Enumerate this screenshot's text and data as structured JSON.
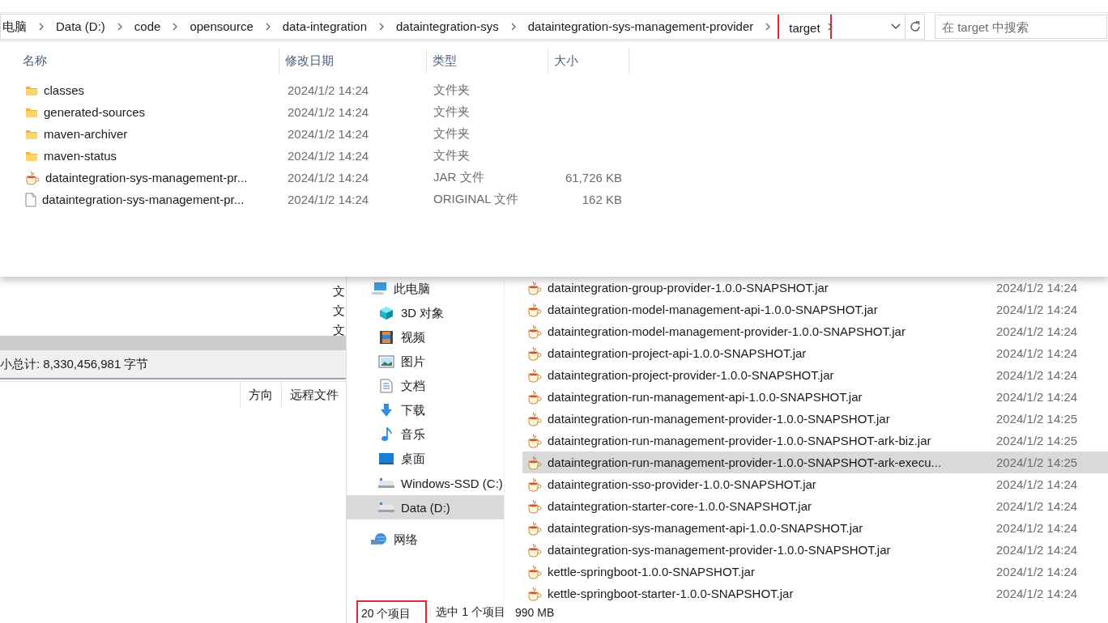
{
  "top_window": {
    "breadcrumb": [
      {
        "label": "电脑",
        "highlighted": false
      },
      {
        "label": "Data (D:)",
        "highlighted": false
      },
      {
        "label": "code",
        "highlighted": false
      },
      {
        "label": "opensource",
        "highlighted": false
      },
      {
        "label": "data-integration",
        "highlighted": false
      },
      {
        "label": "dataintegration-sys",
        "highlighted": false
      },
      {
        "label": "dataintegration-sys-management-provider",
        "highlighted": false
      },
      {
        "label": "target",
        "highlighted": true
      }
    ],
    "search": {
      "placeholder": "在 target 中搜索"
    },
    "columns": [
      "名称",
      "修改日期",
      "类型",
      "大小"
    ],
    "rows": [
      {
        "kind": "folder",
        "name": "classes",
        "modified": "2024/1/2 14:24",
        "type": "文件夹"
      },
      {
        "kind": "folder",
        "name": "generated-sources",
        "modified": "2024/1/2 14:24",
        "type": "文件夹"
      },
      {
        "kind": "folder",
        "name": "maven-archiver",
        "modified": "2024/1/2 14:24",
        "type": "文件夹"
      },
      {
        "kind": "folder",
        "name": "maven-status",
        "modified": "2024/1/2 14:24",
        "type": "文件夹"
      },
      {
        "kind": "jar",
        "name": "dataintegration-sys-management-pr...",
        "modified": "2024/1/2 14:24",
        "type": "JAR 文件",
        "size": "61,726 KB"
      },
      {
        "kind": "file",
        "name": "dataintegration-sys-management-pr...",
        "modified": "2024/1/2 14:24",
        "type": "ORIGINAL 文件",
        "size": "162 KB"
      }
    ]
  },
  "background_app": {
    "cut_cells": [
      "文",
      "文",
      "文"
    ],
    "total": "小总计: 8,330,456,981 字节",
    "columns": [
      "方向",
      "远程文件"
    ]
  },
  "explorer": {
    "nav": [
      {
        "kind": "pc",
        "label": "此电脑",
        "selected": false,
        "children": [
          {
            "kind": "cube",
            "label": "3D 对象",
            "selected": false
          },
          {
            "kind": "video",
            "label": "视频",
            "selected": false
          },
          {
            "kind": "pictures",
            "label": "图片",
            "selected": false
          },
          {
            "kind": "document",
            "label": "文档",
            "selected": false
          },
          {
            "kind": "download",
            "label": "下载",
            "selected": false
          },
          {
            "kind": "music",
            "label": "音乐",
            "selected": false
          },
          {
            "kind": "desktop",
            "label": "桌面",
            "selected": false
          },
          {
            "kind": "drive",
            "label": "Windows-SSD (C:)",
            "selected": false
          },
          {
            "kind": "drive",
            "label": "Data (D:)",
            "selected": true
          }
        ]
      },
      {
        "kind": "network",
        "label": "网络",
        "selected": false
      }
    ],
    "files": [
      {
        "name": "dataintegration-group-provider-1.0.0-SNAPSHOT.jar",
        "modified": "2024/1/2 14:24",
        "selected": false
      },
      {
        "name": "dataintegration-model-management-api-1.0.0-SNAPSHOT.jar",
        "modified": "2024/1/2 14:24",
        "selected": false
      },
      {
        "name": "dataintegration-model-management-provider-1.0.0-SNAPSHOT.jar",
        "modified": "2024/1/2 14:24",
        "selected": false
      },
      {
        "name": "dataintegration-project-api-1.0.0-SNAPSHOT.jar",
        "modified": "2024/1/2 14:24",
        "selected": false
      },
      {
        "name": "dataintegration-project-provider-1.0.0-SNAPSHOT.jar",
        "modified": "2024/1/2 14:24",
        "selected": false
      },
      {
        "name": "dataintegration-run-management-api-1.0.0-SNAPSHOT.jar",
        "modified": "2024/1/2 14:24",
        "selected": false
      },
      {
        "name": "dataintegration-run-management-provider-1.0.0-SNAPSHOT.jar",
        "modified": "2024/1/2 14:25",
        "selected": false
      },
      {
        "name": "dataintegration-run-management-provider-1.0.0-SNAPSHOT-ark-biz.jar",
        "modified": "2024/1/2 14:25",
        "selected": false
      },
      {
        "name": "dataintegration-run-management-provider-1.0.0-SNAPSHOT-ark-execu...",
        "modified": "2024/1/2 14:25",
        "selected": true
      },
      {
        "name": "dataintegration-sso-provider-1.0.0-SNAPSHOT.jar",
        "modified": "2024/1/2 14:24",
        "selected": false
      },
      {
        "name": "dataintegration-starter-core-1.0.0-SNAPSHOT.jar",
        "modified": "2024/1/2 14:24",
        "selected": false
      },
      {
        "name": "dataintegration-sys-management-api-1.0.0-SNAPSHOT.jar",
        "modified": "2024/1/2 14:24",
        "selected": false
      },
      {
        "name": "dataintegration-sys-management-provider-1.0.0-SNAPSHOT.jar",
        "modified": "2024/1/2 14:24",
        "selected": false
      },
      {
        "name": "kettle-springboot-1.0.0-SNAPSHOT.jar",
        "modified": "2024/1/2 14:24",
        "selected": false
      },
      {
        "name": "kettle-springboot-starter-1.0.0-SNAPSHOT.jar",
        "modified": "2024/1/2 14:24",
        "selected": false
      }
    ],
    "status": {
      "count": {
        "text": "20 个项目",
        "highlighted": true
      },
      "selection": "选中 1 个项目",
      "size": "990 MB"
    }
  }
}
